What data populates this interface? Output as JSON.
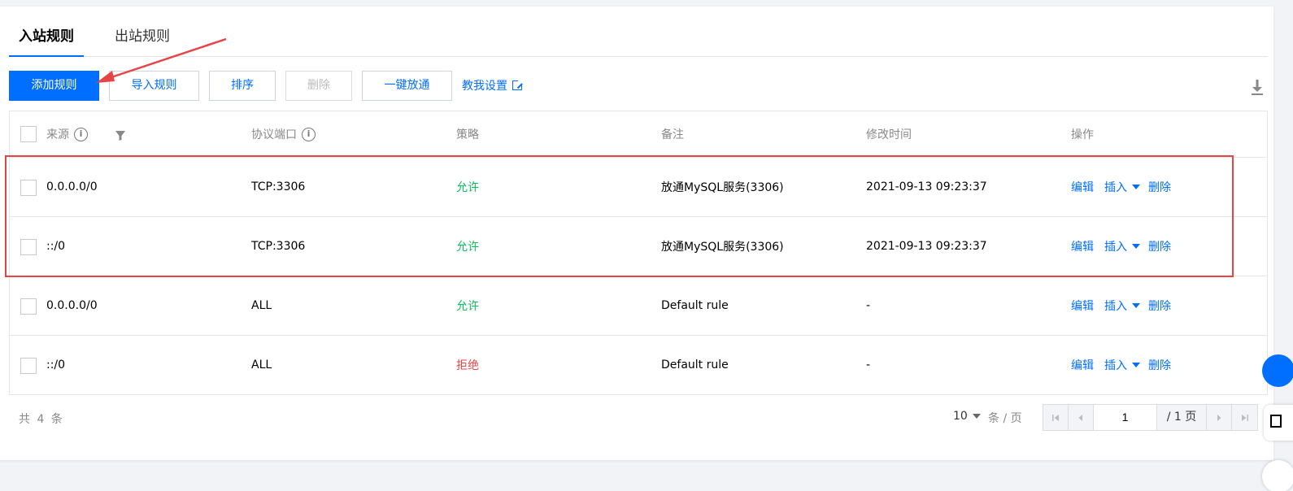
{
  "tabs": [
    {
      "label": "入站规则",
      "active": true
    },
    {
      "label": "出站规则",
      "active": false
    }
  ],
  "toolbar": {
    "add_rule": "添加规则",
    "import_rule": "导入规则",
    "sort": "排序",
    "delete": "删除",
    "one_click_open": "一键放通",
    "teach_me": "教我设置"
  },
  "table": {
    "headers": {
      "source": "来源",
      "protocol_port": "协议端口",
      "policy": "策略",
      "remark": "备注",
      "modified_time": "修改时间",
      "operation": "操作"
    },
    "rows": [
      {
        "source": "0.0.0.0/0",
        "protocol_port": "TCP:3306",
        "policy": "允许",
        "remark": "放通MySQL服务(3306)",
        "modified_time": "2021-09-13 09:23:37",
        "edit": "编辑",
        "insert": "插入",
        "delete": "删除"
      },
      {
        "source": "::/0",
        "protocol_port": "TCP:3306",
        "policy": "允许",
        "remark": "放通MySQL服务(3306)",
        "modified_time": "2021-09-13 09:23:37",
        "edit": "编辑",
        "insert": "插入",
        "delete": "删除"
      },
      {
        "source": "0.0.0.0/0",
        "protocol_port": "ALL",
        "policy": "允许",
        "remark": "Default rule",
        "modified_time": "-",
        "edit": "编辑",
        "insert": "插入",
        "delete": "删除"
      },
      {
        "source": "::/0",
        "protocol_port": "ALL",
        "policy": "拒绝",
        "remark": "Default rule",
        "modified_time": "-",
        "edit": "编辑",
        "insert": "插入",
        "delete": "删除"
      }
    ]
  },
  "pagination": {
    "total": "共 4 条",
    "page_size": "10",
    "per_page": "条 / 页",
    "current_page": "1",
    "total_pages": "/ 1 页"
  },
  "colors": {
    "primary": "#006eff",
    "allow": "#0abf5b",
    "deny": "#e54545",
    "annotation": "#e54545"
  }
}
